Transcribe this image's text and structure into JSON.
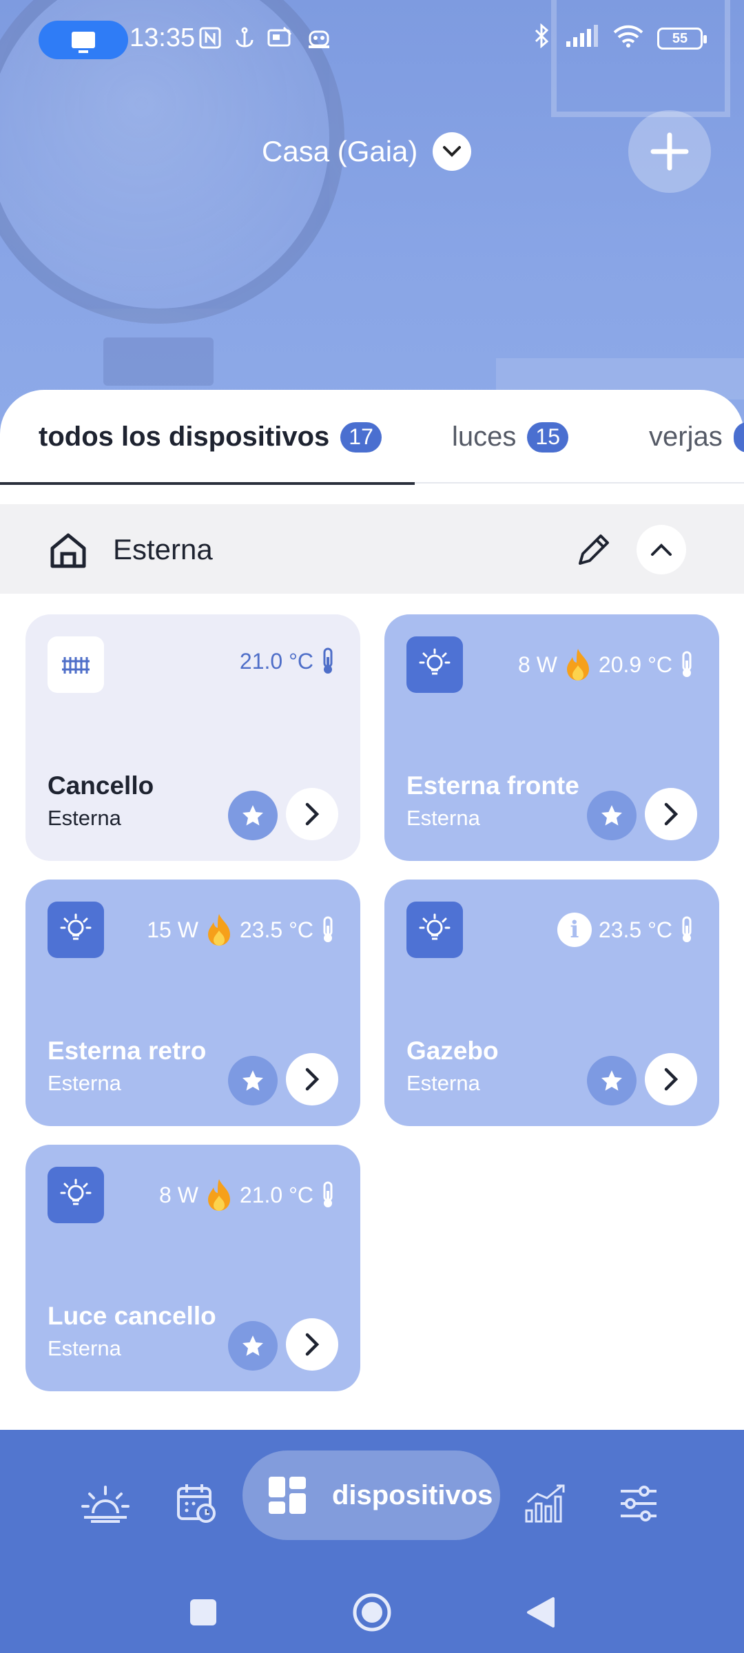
{
  "status_bar": {
    "time": "13:35",
    "battery": "55",
    "icons": [
      "screen-cast-icon",
      "nfc-icon",
      "anchor-icon",
      "card-icon",
      "robot-icon",
      "bluetooth-icon",
      "signal-icon",
      "wifi-icon",
      "battery-icon"
    ]
  },
  "header": {
    "home_name": "Casa (Gaia)",
    "add_icon": "plus-icon"
  },
  "tabs": [
    {
      "label": "todos los dispositivos",
      "count": "17",
      "active": true
    },
    {
      "label": "luces",
      "count": "15",
      "active": false
    },
    {
      "label": "verjas",
      "count": "",
      "active": false
    }
  ],
  "section": {
    "title": "Esterna"
  },
  "devices": [
    {
      "name": "Cancello",
      "room": "Esterna",
      "icon": "gate-icon",
      "power": "",
      "temperature": "21.0 °C",
      "info": false
    },
    {
      "name": "Esterna fronte",
      "room": "Esterna",
      "icon": "bulb-icon",
      "power": "8 W",
      "temperature": "20.9 °C",
      "info": false
    },
    {
      "name": "Esterna retro",
      "room": "Esterna",
      "icon": "bulb-icon",
      "power": "15 W",
      "temperature": "23.5 °C",
      "info": false
    },
    {
      "name": "Gazebo",
      "room": "Esterna",
      "icon": "bulb-icon",
      "power": "",
      "temperature": "23.5 °C",
      "info": true
    },
    {
      "name": "Luce cancello",
      "room": "Esterna",
      "icon": "bulb-icon",
      "power": "8 W",
      "temperature": "21.0 °C",
      "info": false
    }
  ],
  "bottom_nav": {
    "active_label": "dispositivos",
    "items": [
      "sunrise-icon",
      "calendar-icon",
      "dashboard-icon",
      "chart-icon",
      "sliders-icon"
    ]
  },
  "colors": {
    "accent": "#4e72d4",
    "nav_bg": "#5276cf",
    "card_active": "#a9bdf0",
    "card_inactive": "#ecedf8"
  }
}
